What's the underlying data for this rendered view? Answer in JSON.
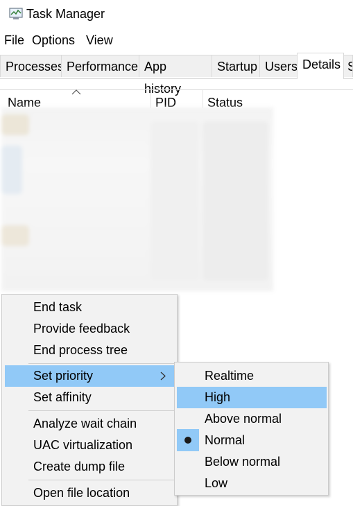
{
  "window": {
    "title": "Task Manager"
  },
  "menubar": [
    "File",
    "Options",
    "View"
  ],
  "tabs": [
    "Processes",
    "Performance",
    "App history",
    "Startup",
    "Users",
    "Details",
    "S"
  ],
  "active_tab": "Details",
  "columns": [
    "Name",
    "PID",
    "Status"
  ],
  "context_menu": {
    "items": [
      "End task",
      "Provide feedback",
      "End process tree",
      "Set priority",
      "Set affinity",
      "Analyze wait chain",
      "UAC virtualization",
      "Create dump file",
      "Open file location"
    ],
    "highlighted": "Set priority"
  },
  "priority_submenu": {
    "items": [
      "Realtime",
      "High",
      "Above normal",
      "Normal",
      "Below normal",
      "Low"
    ],
    "highlighted": "High",
    "selected": "Normal"
  },
  "colors": {
    "highlight": "#91c9f7",
    "menu_bg": "#f2f2f2"
  }
}
